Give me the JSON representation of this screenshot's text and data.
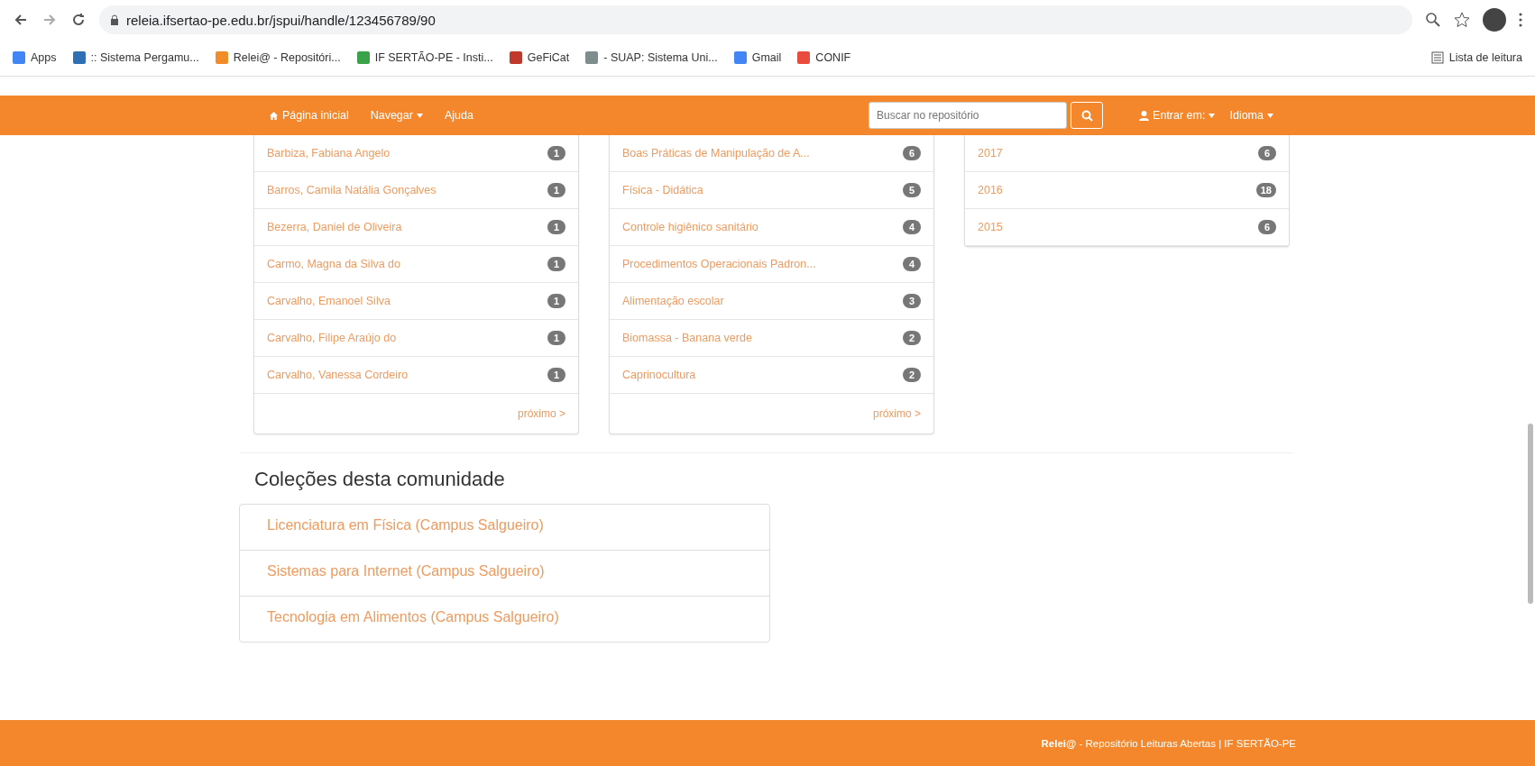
{
  "browser": {
    "url": "releia.ifsertao-pe.edu.br/jspui/handle/123456789/90",
    "bookmarks": [
      {
        "label": "Apps",
        "color": "#4285f4"
      },
      {
        "label": ":: Sistema Pergamu...",
        "color": "#2f6fb4"
      },
      {
        "label": "Relei@ - Repositóri...",
        "color": "#f28c28"
      },
      {
        "label": "IF SERTÃO-PE - Insti...",
        "color": "#3aa34a"
      },
      {
        "label": "GeFiCat",
        "color": "#c0392b"
      },
      {
        "label": "- SUAP: Sistema Uni...",
        "color": "#7f8c8d"
      },
      {
        "label": "Gmail",
        "color": "#4285f4"
      },
      {
        "label": "CONIF",
        "color": "#e74c3c"
      }
    ],
    "reading_list": "Lista de leitura"
  },
  "navbar": {
    "items": [
      {
        "label": "Página inicial",
        "kind": "home"
      },
      {
        "label": "Navegar",
        "kind": "dropdown"
      },
      {
        "label": "Ajuda",
        "kind": "link"
      }
    ],
    "search": {
      "placeholder": "Buscar no repositório"
    },
    "login": "Entrar em:",
    "language": "Idioma"
  },
  "browse_lists": [
    {
      "items": [
        {
          "label": "Barbiza, Fabiana Angelo",
          "count": "1"
        },
        {
          "label": "Barros, Camila Natália Gonçalves",
          "count": "1"
        },
        {
          "label": "Bezerra, Daniel de Oliveira",
          "count": "1"
        },
        {
          "label": "Carmo, Magna da Silva do",
          "count": "1"
        },
        {
          "label": "Carvalho, Emanoel Silva",
          "count": "1"
        },
        {
          "label": "Carvalho, Filipe Araújo do",
          "count": "1"
        },
        {
          "label": "Carvalho, Vanessa Cordeiro",
          "count": "1"
        }
      ],
      "next": "próximo >"
    },
    {
      "items": [
        {
          "label": "Boas Práticas de Manipulação de A...",
          "count": "6"
        },
        {
          "label": "Física - Didática",
          "count": "5"
        },
        {
          "label": "Controle higiênico sanitário",
          "count": "4"
        },
        {
          "label": "Procedimentos Operacionais Padron...",
          "count": "4"
        },
        {
          "label": "Alimentação escolar",
          "count": "3"
        },
        {
          "label": "Biomassa - Banana verde",
          "count": "2"
        },
        {
          "label": "Caprinocultura",
          "count": "2"
        }
      ],
      "next": "próximo >"
    },
    {
      "items": [
        {
          "label": "2017",
          "count": "6"
        },
        {
          "label": "2016",
          "count": "18"
        },
        {
          "label": "2015",
          "count": "6"
        }
      ]
    }
  ],
  "collections": {
    "title": "Coleções desta comunidade",
    "items": [
      "Licenciatura em Física (Campus Salgueiro)",
      "Sistemas para Internet (Campus Salgueiro)",
      "Tecnologia em Alimentos (Campus Salgueiro)"
    ]
  },
  "footer": "**Relei@** - Repositório Leituras Abertas | IF SERTÃO-PE"
}
